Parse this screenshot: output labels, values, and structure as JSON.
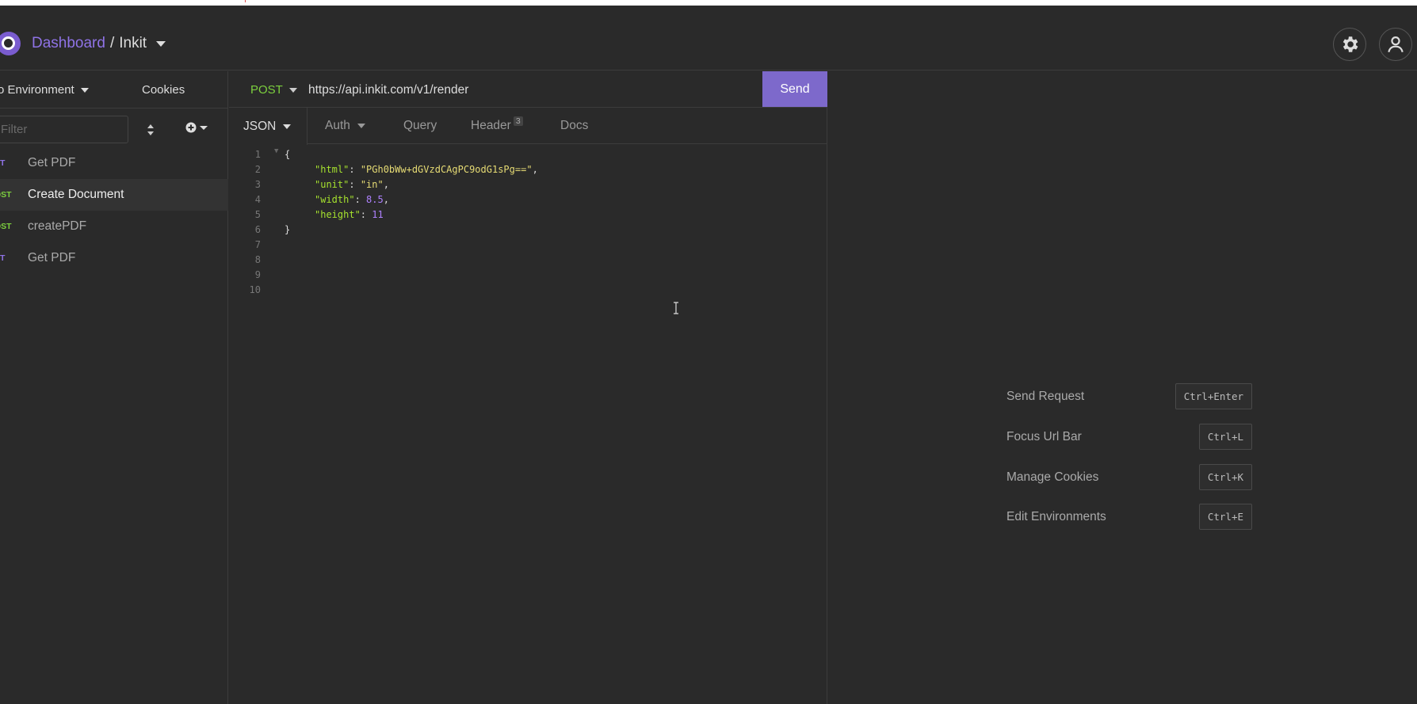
{
  "header": {
    "dashboard_label": "Dashboard",
    "separator": "/",
    "workspace_name": "Inkit"
  },
  "sidebar": {
    "environment_label": "o Environment",
    "cookies_label": "Cookies",
    "filter_placeholder": "Filter",
    "requests": [
      {
        "method": "ET",
        "name": "Get PDF",
        "type": "get"
      },
      {
        "method": "OST",
        "name": "Create Document",
        "type": "post"
      },
      {
        "method": "OST",
        "name": "createPDF",
        "type": "post"
      },
      {
        "method": "ET",
        "name": "Get PDF",
        "type": "get"
      }
    ]
  },
  "request": {
    "method": "POST",
    "url": "https://api.inkit.com/v1/render",
    "send_label": "Send"
  },
  "tabs": {
    "body": "JSON",
    "auth": "Auth",
    "query": "Query",
    "header": "Header",
    "header_count": "3",
    "docs": "Docs"
  },
  "editor": {
    "line_numbers": [
      "1",
      "2",
      "3",
      "4",
      "5",
      "6",
      "7",
      "8",
      "9",
      "10"
    ],
    "open_brace": "{",
    "close_brace": "}",
    "lines": [
      {
        "key": "\"html\"",
        "value": "\"PGh0bWw+dGVzdCAgPC9odG1sPg==\"",
        "value_type": "string",
        "trail": ","
      },
      {
        "key": "\"unit\"",
        "value": "\"in\"",
        "value_type": "string",
        "trail": ","
      },
      {
        "key": "\"width\"",
        "value": "8.5",
        "value_type": "number",
        "trail": ","
      },
      {
        "key": "\"height\"",
        "value": "11",
        "value_type": "number",
        "trail": ""
      }
    ]
  },
  "shortcuts": [
    {
      "label": "Send Request",
      "key": "Ctrl+Enter"
    },
    {
      "label": "Focus Url Bar",
      "key": "Ctrl+L"
    },
    {
      "label": "Manage Cookies",
      "key": "Ctrl+K"
    },
    {
      "label": "Edit Environments",
      "key": "Ctrl+E"
    }
  ],
  "colors": {
    "accent": "#7d69cb",
    "post": "#7ccf3e",
    "get": "#8f73e6"
  }
}
